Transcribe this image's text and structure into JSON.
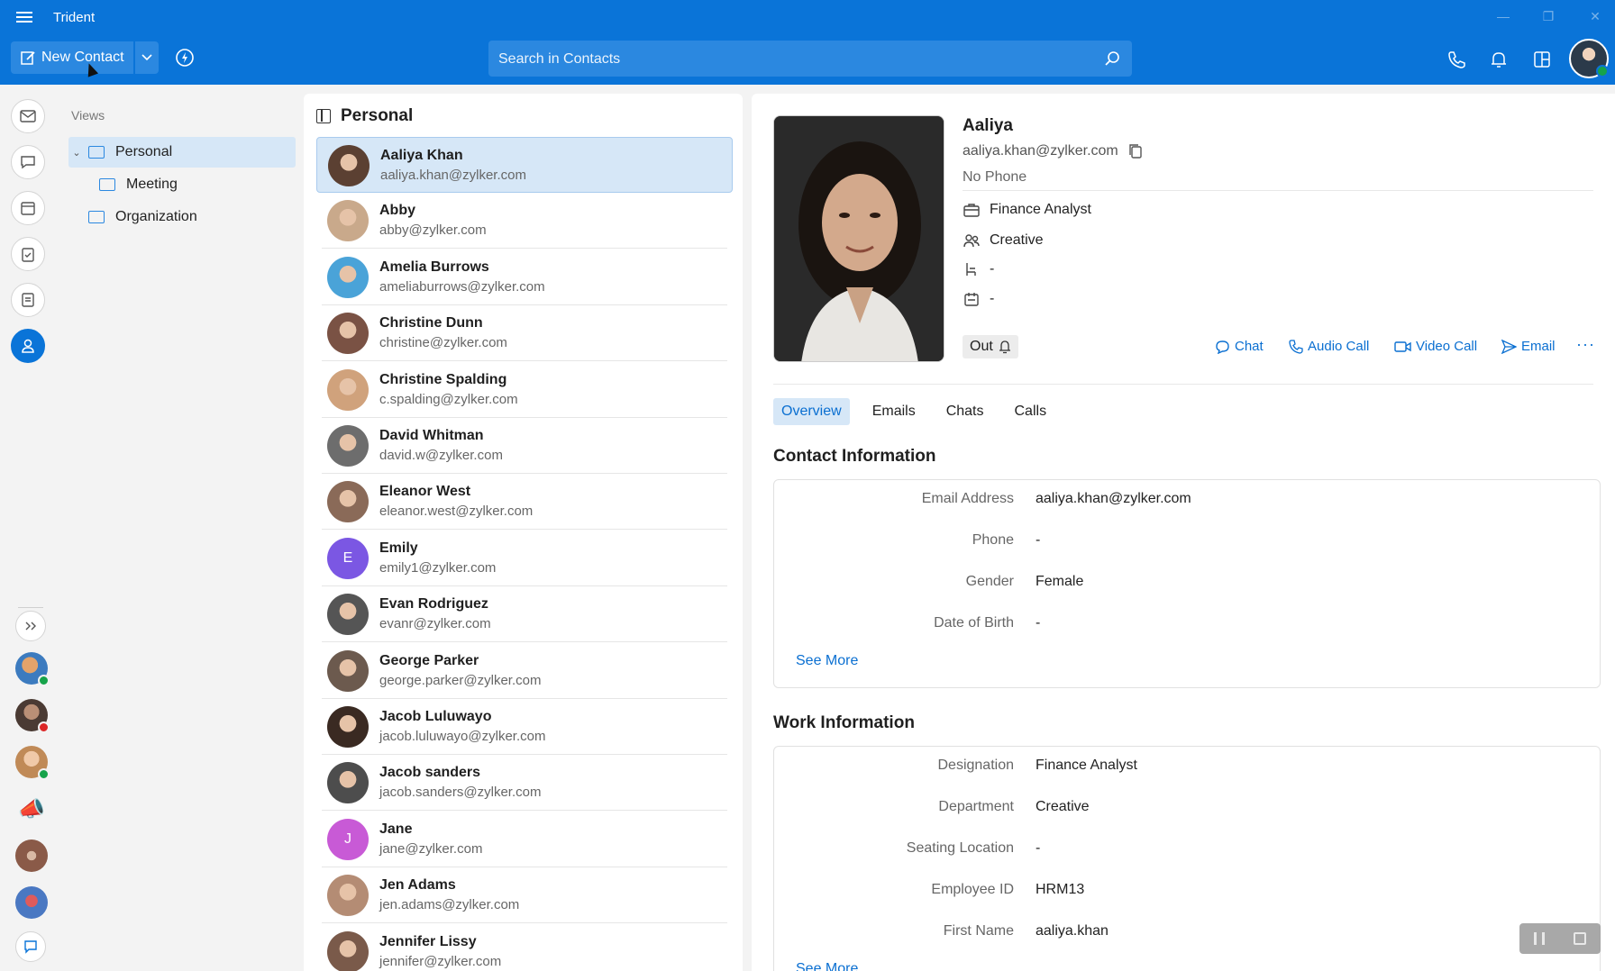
{
  "app": {
    "title": "Trident",
    "brand_color": "#0a74d8",
    "accent_selection": "#d6e7f7"
  },
  "toolbar": {
    "new_contact_label": "New Contact",
    "search_placeholder": "Search in Contacts"
  },
  "views": {
    "header": "Views",
    "items": [
      {
        "label": "Personal",
        "selected": true,
        "expanded": true
      },
      {
        "label": "Meeting",
        "selected": false
      },
      {
        "label": "Organization",
        "selected": false
      }
    ]
  },
  "list": {
    "title": "Personal",
    "contacts": [
      {
        "name": "Aaliya Khan",
        "email": "aaliya.khan@zylker.com",
        "selected": true
      },
      {
        "name": "Abby",
        "email": "abby@zylker.com"
      },
      {
        "name": "Amelia Burrows",
        "email": "ameliaburrows@zylker.com"
      },
      {
        "name": "Christine Dunn",
        "email": "christine@zylker.com"
      },
      {
        "name": "Christine Spalding",
        "email": "c.spalding@zylker.com"
      },
      {
        "name": "David Whitman",
        "email": "david.w@zylker.com"
      },
      {
        "name": "Eleanor West",
        "email": "eleanor.west@zylker.com"
      },
      {
        "name": "Emily",
        "email": "emily1@zylker.com",
        "initial": "E",
        "color": "#7b57e3"
      },
      {
        "name": "Evan Rodriguez",
        "email": "evanr@zylker.com"
      },
      {
        "name": "George Parker",
        "email": "george.parker@zylker.com"
      },
      {
        "name": "Jacob Luluwayo",
        "email": "jacob.luluwayo@zylker.com"
      },
      {
        "name": "Jacob sanders",
        "email": "jacob.sanders@zylker.com"
      },
      {
        "name": "Jane",
        "email": "jane@zylker.com",
        "initial": "J",
        "color": "#c85ad6"
      },
      {
        "name": "Jen Adams",
        "email": "jen.adams@zylker.com"
      },
      {
        "name": "Jennifer Lissy",
        "email": "jennifer@zylker.com"
      }
    ]
  },
  "detail": {
    "name": "Aaliya",
    "email": "aaliya.khan@zylker.com",
    "phone": "No Phone",
    "designation": "Finance Analyst",
    "department": "Creative",
    "seating": "-",
    "employee_id_short": "-",
    "status": "Out",
    "actions": {
      "chat": "Chat",
      "audio": "Audio Call",
      "video": "Video Call",
      "email": "Email"
    },
    "tabs": [
      "Overview",
      "Emails",
      "Chats",
      "Calls"
    ],
    "contact_section": {
      "title": "Contact Information",
      "fields": [
        {
          "label": "Email Address",
          "value": "aaliya.khan@zylker.com"
        },
        {
          "label": "Phone",
          "value": "-"
        },
        {
          "label": "Gender",
          "value": "Female"
        },
        {
          "label": "Date of Birth",
          "value": "-"
        }
      ],
      "see_more": "See More"
    },
    "work_section": {
      "title": "Work Information",
      "fields": [
        {
          "label": "Designation",
          "value": "Finance Analyst"
        },
        {
          "label": "Department",
          "value": "Creative"
        },
        {
          "label": "Seating Location",
          "value": "-"
        },
        {
          "label": "Employee ID",
          "value": "HRM13"
        },
        {
          "label": "First Name",
          "value": "aaliya.khan"
        }
      ],
      "see_more": "See More"
    }
  }
}
